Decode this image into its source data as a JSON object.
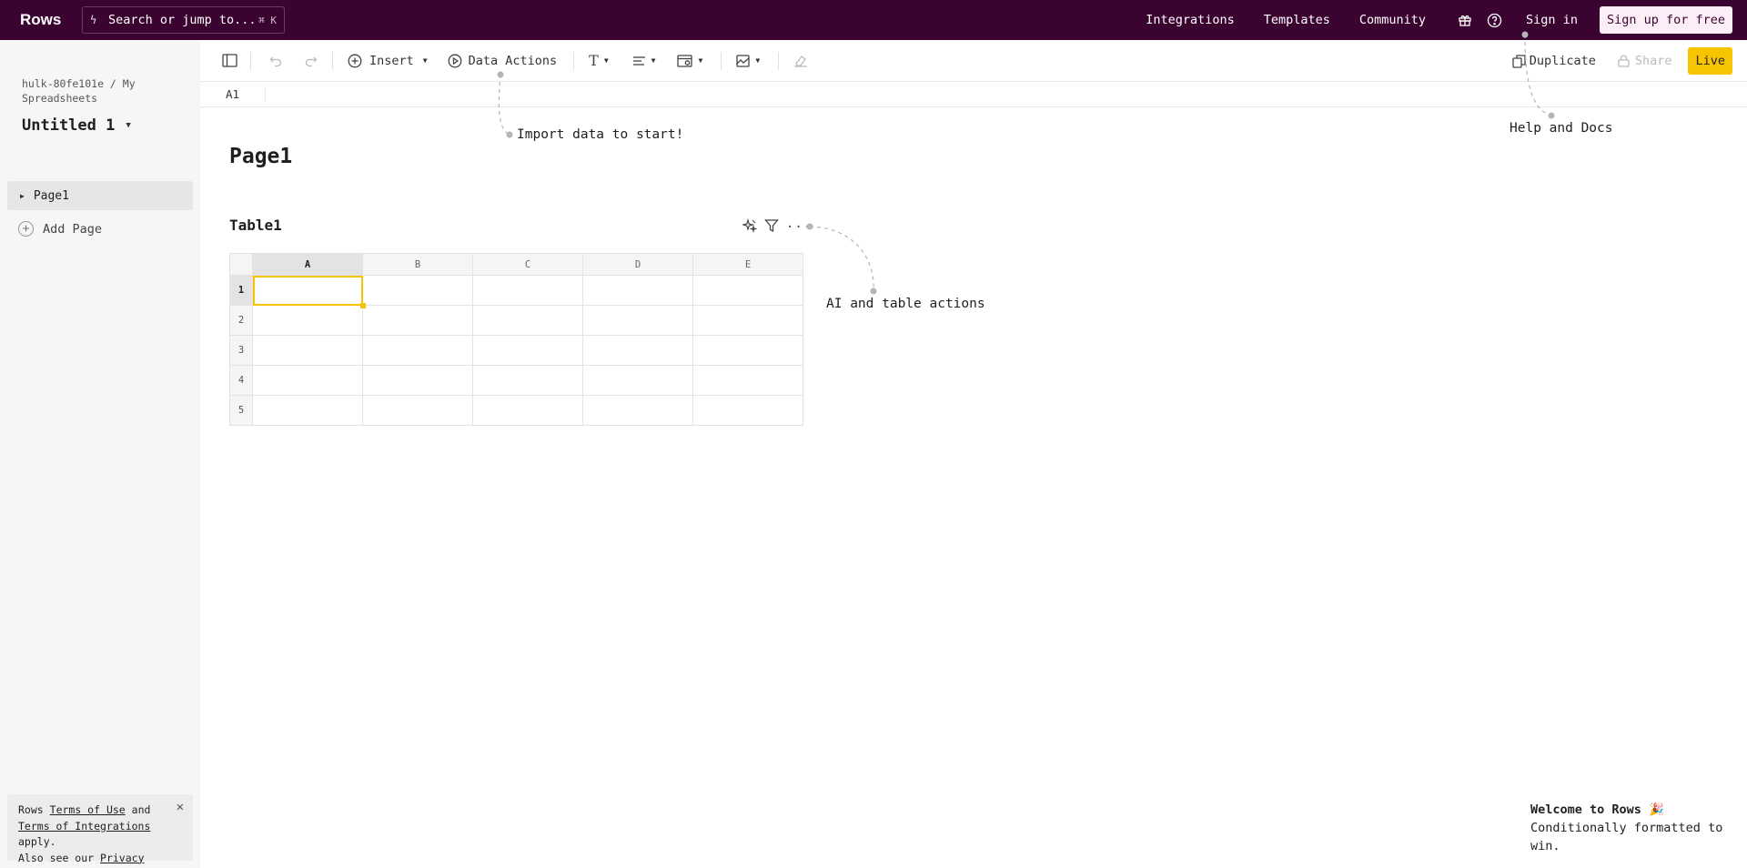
{
  "topbar": {
    "logo": "Rows",
    "search_placeholder": "Search or jump to...",
    "search_shortcut": "⌘ K",
    "links": [
      "Integrations",
      "Templates",
      "Community"
    ],
    "sign_in": "Sign in",
    "sign_up": "Sign up for free",
    "brand_color": "#3b0430"
  },
  "sidebar": {
    "breadcrumb": "hulk-80fe101e / My Spreadsheets",
    "doc_title": "Untitled 1",
    "pages": [
      {
        "label": "Page1"
      }
    ],
    "add_page": "Add Page",
    "terms": {
      "prefix": "Rows",
      "terms_of_use": "Terms of Use",
      "and": "and",
      "terms_of_integrations": "Terms of Integrations",
      "apply": "apply.",
      "also": "Also see our",
      "privacy": "Privacy policy",
      "period": "."
    }
  },
  "toolbar": {
    "insert": "Insert",
    "data_actions": "Data Actions",
    "duplicate": "Duplicate",
    "share": "Share",
    "live": "Live",
    "accent_color": "#f7c500"
  },
  "formula": {
    "cell_ref": "A1"
  },
  "canvas": {
    "page_title": "Page1",
    "table_title": "Table1",
    "columns": [
      "A",
      "B",
      "C",
      "D",
      "E"
    ],
    "rows": [
      "1",
      "2",
      "3",
      "4",
      "5"
    ],
    "selected_cell": "A1"
  },
  "hints": {
    "import": "Import data to start!",
    "help": "Help and Docs",
    "ai": "AI and table actions"
  },
  "welcome": {
    "title": "Welcome to Rows 🎉",
    "subtitle": "Conditionally formatted to win."
  }
}
